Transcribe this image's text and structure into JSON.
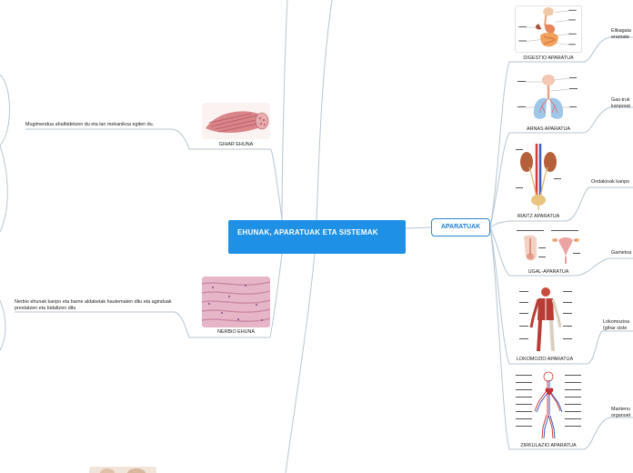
{
  "central": {
    "title": "EHUNAK, APARATUAK ETA SISTEMAK"
  },
  "aparatuak": {
    "label": "APARATUAK"
  },
  "tissues": [
    {
      "name": "GIHAR EHUNA",
      "note": "Mugimendua ahalbidetzen du eta lan mekanikoa egiten du."
    },
    {
      "name": "NERBIO EHUNA",
      "note": "Nerbio ehunak kanpo eta barne aldaketak hautematen ditu eta aginduak prestatzen eta bidaltzen ditu"
    }
  ],
  "systems": [
    {
      "name": "DIGESTIO APARATUA",
      "note": [
        "Elikagaia",
        "eramate"
      ]
    },
    {
      "name": "ARNAS APARATUA",
      "note": [
        "Gas-truk",
        "kanporat"
      ]
    },
    {
      "name": "IRAITZ APARATUA",
      "note": [
        "Ondakinak kanpo"
      ]
    },
    {
      "name": "UGAL-APARATUA",
      "note": [
        "Gametoa"
      ]
    },
    {
      "name": "LOKOMOZIO APARATUA",
      "note": [
        "Lokomoziоa",
        "(gihar siste"
      ]
    },
    {
      "name": "ZIRKULAZIO APARATUA",
      "note": [
        "Mantenu",
        "organoet"
      ]
    }
  ],
  "colors": {
    "central_fill": "#1e90e6",
    "central_text": "#ffffff",
    "node_border": "#2b87d1",
    "line": "#b8c6d2"
  }
}
